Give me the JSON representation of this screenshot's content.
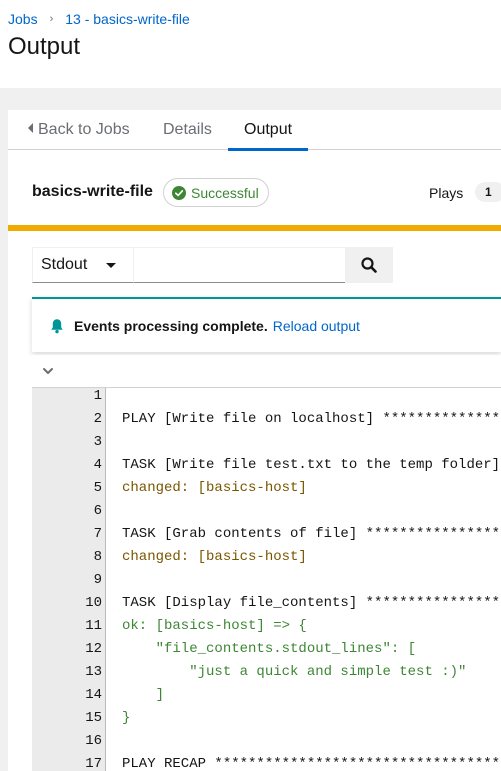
{
  "breadcrumb": {
    "jobs": "Jobs",
    "separator": "›",
    "job": "13 - basics-write-file"
  },
  "page_title": "Output",
  "tabs": [
    {
      "label": "Back to Jobs"
    },
    {
      "label": "Details"
    },
    {
      "label": "Output",
      "active": true
    }
  ],
  "job": {
    "name": "basics-write-file",
    "status": "Successful",
    "plays_label": "Plays",
    "plays_count": "1"
  },
  "filter": {
    "selected": "Stdout",
    "search_value": "",
    "search_placeholder": ""
  },
  "alert": {
    "title": "Events processing complete.",
    "link": "Reload output"
  },
  "output_lines": [
    {
      "num": "1",
      "text": "",
      "style": "plain"
    },
    {
      "num": "2",
      "text": "PLAY [Write file on localhost] ****************",
      "style": "plain"
    },
    {
      "num": "3",
      "text": "",
      "style": "plain"
    },
    {
      "num": "4",
      "text": "TASK [Write file test.txt to the temp folder] **",
      "style": "plain"
    },
    {
      "num": "5",
      "text": "changed: [basics-host]",
      "style": "changed"
    },
    {
      "num": "6",
      "text": "",
      "style": "plain"
    },
    {
      "num": "7",
      "text": "TASK [Grab contents of file] ******************",
      "style": "plain"
    },
    {
      "num": "8",
      "text": "changed: [basics-host]",
      "style": "changed"
    },
    {
      "num": "9",
      "text": "",
      "style": "plain"
    },
    {
      "num": "10",
      "text": "TASK [Display file_contents] ******************",
      "style": "plain"
    },
    {
      "num": "11",
      "text": "ok: [basics-host] => {",
      "style": "ok"
    },
    {
      "num": "12",
      "text": "    \"file_contents.stdout_lines\": [",
      "style": "ok"
    },
    {
      "num": "13",
      "text": "        \"just a quick and simple test :)\"",
      "style": "ok"
    },
    {
      "num": "14",
      "text": "    ]",
      "style": "ok"
    },
    {
      "num": "15",
      "text": "}",
      "style": "ok"
    },
    {
      "num": "16",
      "text": "",
      "style": "plain"
    },
    {
      "num": "17",
      "text": "PLAY RECAP ************************************",
      "style": "plain"
    }
  ],
  "colors": {
    "link": "#0066cc",
    "success": "#3e8635",
    "changed": "#795600",
    "progress": "#f0ab00",
    "alert_accent": "#009596",
    "tab_active": "#0066cc"
  },
  "icons": {
    "status": "check-circle-icon",
    "alert": "bell-icon",
    "search": "search-icon",
    "collapse": "chevron-down-icon",
    "select": "caret-down-icon",
    "back": "caret-left-icon"
  }
}
